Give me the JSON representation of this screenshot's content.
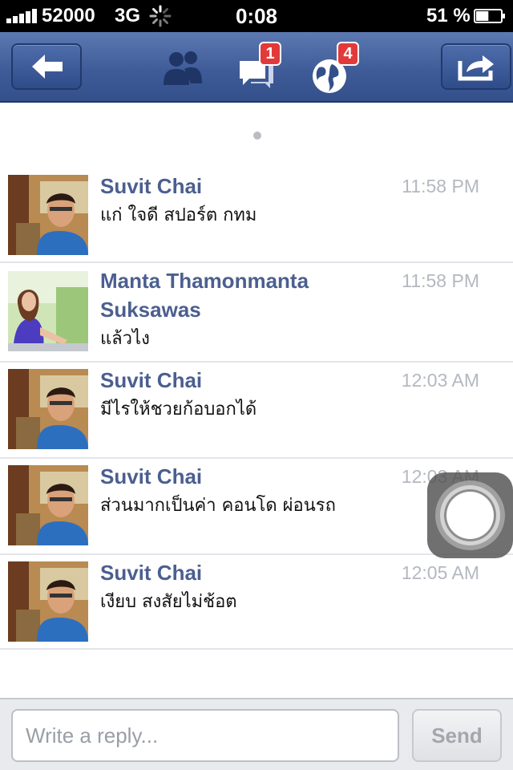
{
  "status_bar": {
    "carrier": "52000",
    "network": "3G",
    "time": "0:08",
    "battery": "51 %",
    "battery_level": 0.51
  },
  "nav": {
    "back_icon": "arrow-left-icon",
    "friend_requests_icon": "friends-icon",
    "messages_icon": "messages-icon",
    "messages_badge": "1",
    "notifications_icon": "globe-icon",
    "notifications_badge": "4",
    "share_icon": "share-icon"
  },
  "colors": {
    "nav_bar": "#3f5c98",
    "sender_name": "#4b5f8f",
    "badge": "#e23a3a"
  },
  "messages": [
    {
      "sender": "Suvit Chai",
      "time": "11:58 PM",
      "text": "แก่ ใจดี สปอร์ต กทม"
    },
    {
      "sender": "Manta Thamonmanta Suksawas",
      "time": "11:58 PM",
      "text": "แล้วไง"
    },
    {
      "sender": "Suvit Chai",
      "time": "12:03 AM",
      "text": "มีไรให้ชวยก้อบอกได้"
    },
    {
      "sender": "Suvit Chai",
      "time": "12:03 AM",
      "text": "ส่วนมากเป็นค่า คอนโด ผ่อนรถ"
    },
    {
      "sender": "Suvit Chai",
      "time": "12:05 AM",
      "text": "เงียบ สงสัยไม่ช้อต"
    }
  ],
  "reply": {
    "placeholder": "Write a reply...",
    "send_label": "Send"
  }
}
